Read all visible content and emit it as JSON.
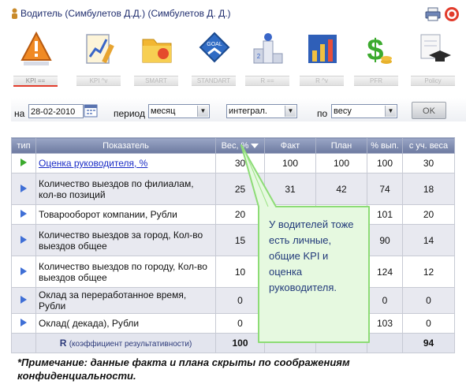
{
  "header": {
    "title": "Водитель (Симбулетов Д.Д.)  (Симбулетов Д. Д.)"
  },
  "toolbar": {
    "items": [
      {
        "label": "KPI ==",
        "icon": "kpi-warning-icon"
      },
      {
        "label": "KPI ^v",
        "icon": "kpi-chart-icon"
      },
      {
        "label": "SMART",
        "icon": "smart-folder-icon"
      },
      {
        "label": "STANDART",
        "icon": "goal-icon"
      },
      {
        "label": "R ==",
        "icon": "ranking-podium-icon"
      },
      {
        "label": "R ^v",
        "icon": "bar-chart-icon"
      },
      {
        "label": "PFR",
        "icon": "dollar-icon"
      },
      {
        "label": "Policy",
        "icon": "graduation-cap-icon"
      }
    ]
  },
  "filters": {
    "on_label": "на",
    "date": "28-02-2010",
    "period_label": "период",
    "period": "месяц",
    "mode": "интеграл.",
    "by_label": "по",
    "by": "весу",
    "ok": "OK"
  },
  "table": {
    "headers": [
      "тип",
      "Показатель",
      "Вес, %",
      "Факт",
      "План",
      "% вып.",
      "с уч. веса"
    ],
    "rows": [
      {
        "name": "Оценка руководителя, %",
        "link": true,
        "marker": "green",
        "weight": "30",
        "fact": "100",
        "plan": "100",
        "pct": "100",
        "weighted": "30"
      },
      {
        "name": "Количество выездов по филиалам, кол-во позиций",
        "link": false,
        "marker": "blue",
        "weight": "25",
        "fact": "31",
        "plan": "42",
        "pct": "74",
        "weighted": "18"
      },
      {
        "name": "Товарооборот компании, Рубли",
        "link": false,
        "marker": "blue",
        "weight": "20",
        "fact": "",
        "plan": "",
        "pct": "101",
        "weighted": "20"
      },
      {
        "name": "Количество выездов за город, Кол-во выездов общее",
        "link": false,
        "marker": "blue",
        "weight": "15",
        "fact": "",
        "plan": "",
        "pct": "90",
        "weighted": "14"
      },
      {
        "name": "Количество выездов по городу, Кол-во выездов общее",
        "link": false,
        "marker": "blue",
        "weight": "10",
        "fact": "",
        "plan": "",
        "pct": "124",
        "weighted": "12"
      },
      {
        "name": "Оклад за переработанное время, Рубли",
        "link": false,
        "marker": "blue",
        "weight": "0",
        "fact": "",
        "plan": "",
        "pct": "0",
        "weighted": "0"
      },
      {
        "name": "Оклад( декада), Рубли",
        "link": false,
        "marker": "blue",
        "weight": "0",
        "fact": "",
        "plan": "",
        "pct": "103",
        "weighted": "0"
      }
    ],
    "summary": {
      "label": "R",
      "sub": "(коэффициент результативности)",
      "weight": "100",
      "weighted": "94"
    }
  },
  "callout": {
    "lines": [
      "У водителей тоже",
      "есть личные,",
      "общие KPI и",
      "оценка",
      "руководителя."
    ]
  },
  "note": "*Примечание: данные факта и плана скрыты по соображениям конфиденциальности."
}
